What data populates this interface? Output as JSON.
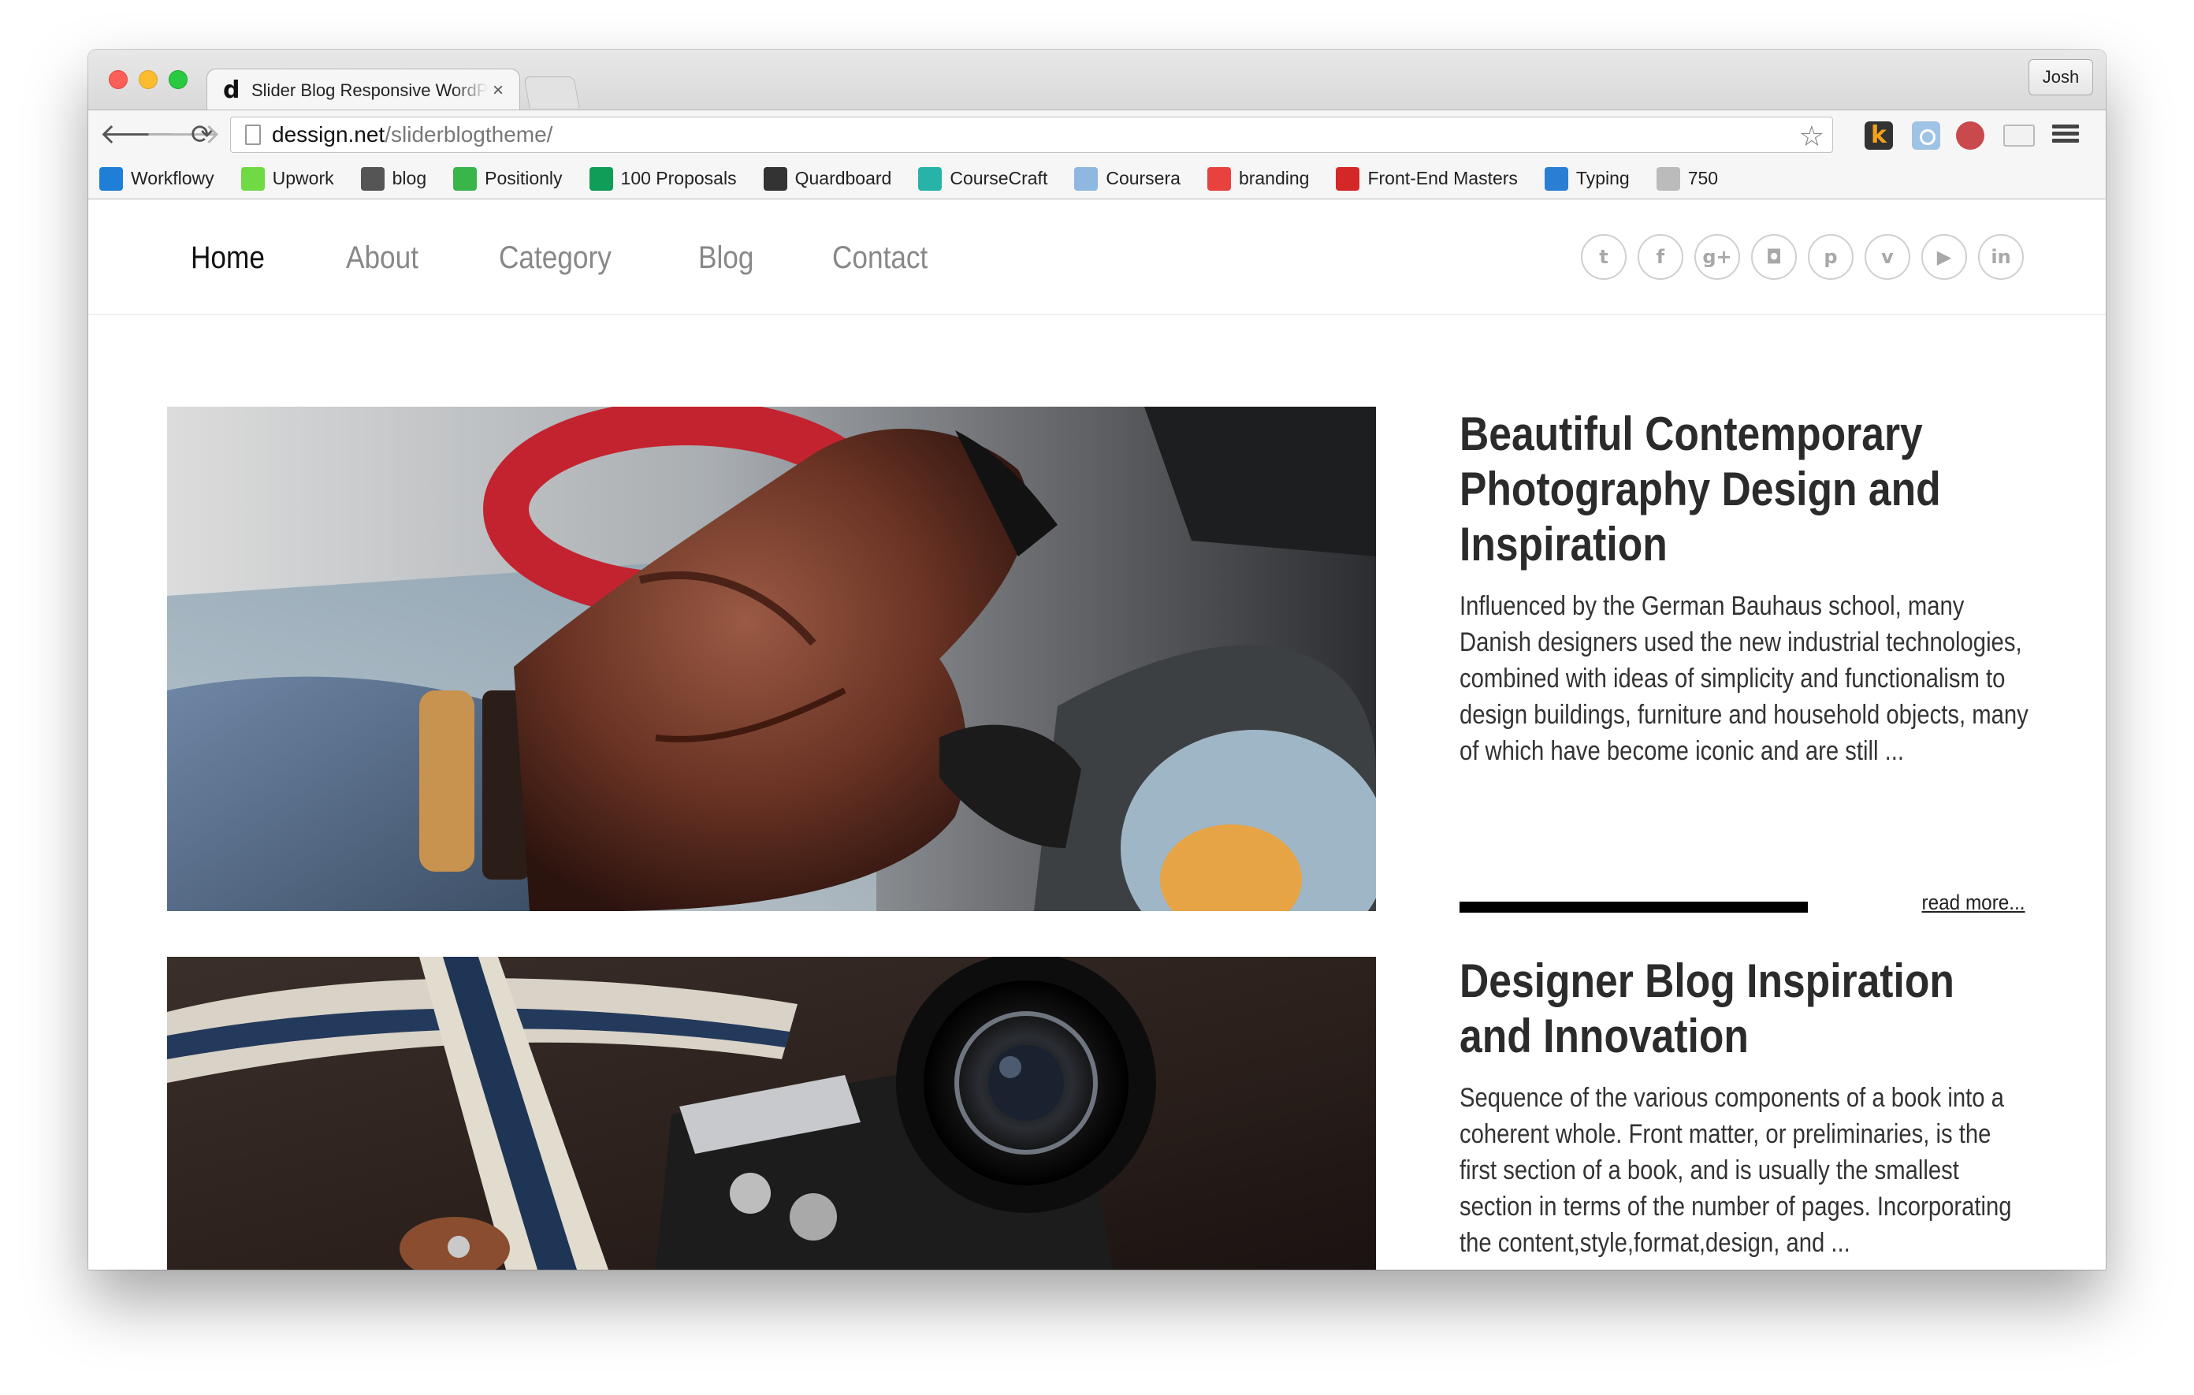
{
  "browser": {
    "tab_title": "Slider Blog Responsive WordPress Theme",
    "tab_favicon": "d",
    "close_glyph": "×",
    "profile": "Josh",
    "url_host": "dessign.net",
    "url_path": "/sliderblogtheme/",
    "ext_k": "k",
    "bookmarks": [
      {
        "label": "Workflowy",
        "icon": "workflowy-icon",
        "color": "#1f7fd6"
      },
      {
        "label": "Upwork",
        "icon": "upwork-icon",
        "color": "#6fda44"
      },
      {
        "label": "blog",
        "icon": "blog-icon",
        "color": "#555555"
      },
      {
        "label": "Positionly",
        "icon": "positionly-icon",
        "color": "#39b54a"
      },
      {
        "label": "100 Proposals",
        "icon": "sheet-icon",
        "color": "#0f9d58"
      },
      {
        "label": "Quardboard",
        "icon": "cube-icon",
        "color": "#333333"
      },
      {
        "label": "CourseCraft",
        "icon": "coursecraft-icon",
        "color": "#27b3a7"
      },
      {
        "label": "Coursera",
        "icon": "folder-icon",
        "color": "#8fb8e0"
      },
      {
        "label": "branding",
        "icon": "branding-icon",
        "color": "#e8423f"
      },
      {
        "label": "Front-End  Masters",
        "icon": "frontend-masters-icon",
        "color": "#d42828"
      },
      {
        "label": "Typing",
        "icon": "typing-icon",
        "color": "#2a7fd4"
      },
      {
        "label": "750",
        "icon": "page-icon",
        "color": "#bbbbbb"
      }
    ]
  },
  "site": {
    "menu": [
      "Home",
      "About",
      "Category",
      "Blog",
      "Contact"
    ],
    "socials": [
      {
        "icon": "twitter-icon",
        "glyph": "t"
      },
      {
        "icon": "facebook-icon",
        "glyph": "f"
      },
      {
        "icon": "google-plus-icon",
        "glyph": "g+"
      },
      {
        "icon": "instagram-icon",
        "glyph": "◘"
      },
      {
        "icon": "pinterest-icon",
        "glyph": "p"
      },
      {
        "icon": "vimeo-icon",
        "glyph": "v"
      },
      {
        "icon": "youtube-icon",
        "glyph": "▶"
      },
      {
        "icon": "linkedin-icon",
        "glyph": "in"
      }
    ]
  },
  "posts": [
    {
      "title": "Beautiful Contemporary Photography Design and Inspiration",
      "excerpt": "Influenced by the German Bauhaus school, many Danish designers used the new industrial technologies, combined with ideas of simplicity and functionalism to design buildings, furniture and household objects, many of which have become iconic and are still ...",
      "read_more": "read more...",
      "image": "leather-glove-on-steering-wheel"
    },
    {
      "title": "Designer Blog Inspiration and Innovation",
      "excerpt": "Sequence of the various components of a book into a coherent whole. Front matter, or preliminaries, is the first section of a book, and is usually the smallest section in terms of the number of pages. Incorporating the content,style,format,design, and ...",
      "image": "vintage-camera-with-strap"
    }
  ]
}
